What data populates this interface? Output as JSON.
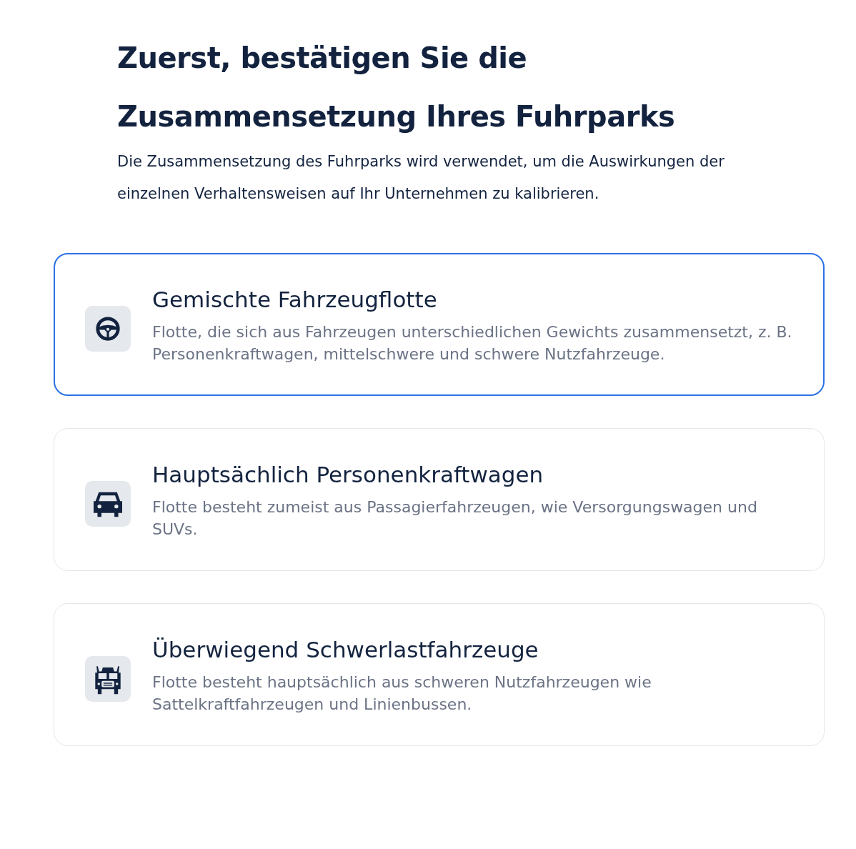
{
  "heading": "Zuerst, bestätigen Sie die Zusammensetzung Ihres Fuhrparks",
  "description": "Die Zusammensetzung des Fuhrparks wird verwendet, um die Auswirkungen der einzelnen Verhaltensweisen auf Ihr Unternehmen zu kalibrieren.",
  "options": [
    {
      "kind": "wheel",
      "title": "Gemischte Fahrzeugflotte",
      "text": "Flotte, die sich aus Fahrzeugen unterschiedlichen Gewichts zusammensetzt, z. B. Personenkraftwagen, mittelschwere und schwere Nutzfahrzeuge.",
      "selected": true
    },
    {
      "kind": "car",
      "title": "Hauptsächlich Personenkraftwagen",
      "text": "Flotte besteht zumeist aus Passagierfahrzeugen, wie Versorgungswagen und SUVs.",
      "selected": false
    },
    {
      "kind": "truck",
      "title": "Überwiegend Schwerlastfahrzeuge",
      "text": "Flotte besteht hauptsächlich aus schweren Nutzfahrzeugen wie Sattelkraftfahrzeugen und Linienbussen.",
      "selected": false
    }
  ]
}
